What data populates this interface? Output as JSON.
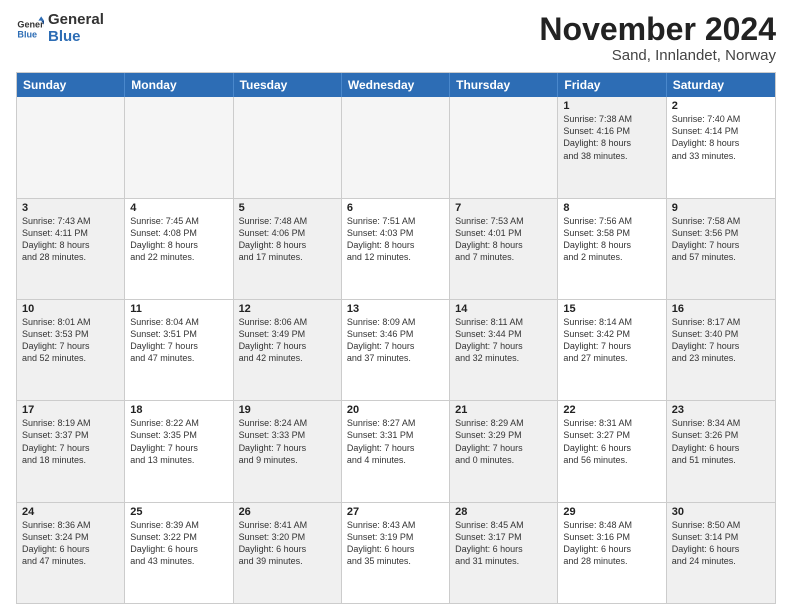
{
  "logo": {
    "line1": "General",
    "line2": "Blue"
  },
  "title": "November 2024",
  "subtitle": "Sand, Innlandet, Norway",
  "days": [
    "Sunday",
    "Monday",
    "Tuesday",
    "Wednesday",
    "Thursday",
    "Friday",
    "Saturday"
  ],
  "rows": [
    [
      {
        "day": "",
        "info": "",
        "empty": true
      },
      {
        "day": "",
        "info": "",
        "empty": true
      },
      {
        "day": "",
        "info": "",
        "empty": true
      },
      {
        "day": "",
        "info": "",
        "empty": true
      },
      {
        "day": "",
        "info": "",
        "empty": true
      },
      {
        "day": "1",
        "info": "Sunrise: 7:38 AM\nSunset: 4:16 PM\nDaylight: 8 hours\nand 38 minutes.",
        "shaded": true
      },
      {
        "day": "2",
        "info": "Sunrise: 7:40 AM\nSunset: 4:14 PM\nDaylight: 8 hours\nand 33 minutes.",
        "shaded": false
      }
    ],
    [
      {
        "day": "3",
        "info": "Sunrise: 7:43 AM\nSunset: 4:11 PM\nDaylight: 8 hours\nand 28 minutes.",
        "shaded": true
      },
      {
        "day": "4",
        "info": "Sunrise: 7:45 AM\nSunset: 4:08 PM\nDaylight: 8 hours\nand 22 minutes.",
        "shaded": false
      },
      {
        "day": "5",
        "info": "Sunrise: 7:48 AM\nSunset: 4:06 PM\nDaylight: 8 hours\nand 17 minutes.",
        "shaded": true
      },
      {
        "day": "6",
        "info": "Sunrise: 7:51 AM\nSunset: 4:03 PM\nDaylight: 8 hours\nand 12 minutes.",
        "shaded": false
      },
      {
        "day": "7",
        "info": "Sunrise: 7:53 AM\nSunset: 4:01 PM\nDaylight: 8 hours\nand 7 minutes.",
        "shaded": true
      },
      {
        "day": "8",
        "info": "Sunrise: 7:56 AM\nSunset: 3:58 PM\nDaylight: 8 hours\nand 2 minutes.",
        "shaded": false
      },
      {
        "day": "9",
        "info": "Sunrise: 7:58 AM\nSunset: 3:56 PM\nDaylight: 7 hours\nand 57 minutes.",
        "shaded": true
      }
    ],
    [
      {
        "day": "10",
        "info": "Sunrise: 8:01 AM\nSunset: 3:53 PM\nDaylight: 7 hours\nand 52 minutes.",
        "shaded": true
      },
      {
        "day": "11",
        "info": "Sunrise: 8:04 AM\nSunset: 3:51 PM\nDaylight: 7 hours\nand 47 minutes.",
        "shaded": false
      },
      {
        "day": "12",
        "info": "Sunrise: 8:06 AM\nSunset: 3:49 PM\nDaylight: 7 hours\nand 42 minutes.",
        "shaded": true
      },
      {
        "day": "13",
        "info": "Sunrise: 8:09 AM\nSunset: 3:46 PM\nDaylight: 7 hours\nand 37 minutes.",
        "shaded": false
      },
      {
        "day": "14",
        "info": "Sunrise: 8:11 AM\nSunset: 3:44 PM\nDaylight: 7 hours\nand 32 minutes.",
        "shaded": true
      },
      {
        "day": "15",
        "info": "Sunrise: 8:14 AM\nSunset: 3:42 PM\nDaylight: 7 hours\nand 27 minutes.",
        "shaded": false
      },
      {
        "day": "16",
        "info": "Sunrise: 8:17 AM\nSunset: 3:40 PM\nDaylight: 7 hours\nand 23 minutes.",
        "shaded": true
      }
    ],
    [
      {
        "day": "17",
        "info": "Sunrise: 8:19 AM\nSunset: 3:37 PM\nDaylight: 7 hours\nand 18 minutes.",
        "shaded": true
      },
      {
        "day": "18",
        "info": "Sunrise: 8:22 AM\nSunset: 3:35 PM\nDaylight: 7 hours\nand 13 minutes.",
        "shaded": false
      },
      {
        "day": "19",
        "info": "Sunrise: 8:24 AM\nSunset: 3:33 PM\nDaylight: 7 hours\nand 9 minutes.",
        "shaded": true
      },
      {
        "day": "20",
        "info": "Sunrise: 8:27 AM\nSunset: 3:31 PM\nDaylight: 7 hours\nand 4 minutes.",
        "shaded": false
      },
      {
        "day": "21",
        "info": "Sunrise: 8:29 AM\nSunset: 3:29 PM\nDaylight: 7 hours\nand 0 minutes.",
        "shaded": true
      },
      {
        "day": "22",
        "info": "Sunrise: 8:31 AM\nSunset: 3:27 PM\nDaylight: 6 hours\nand 56 minutes.",
        "shaded": false
      },
      {
        "day": "23",
        "info": "Sunrise: 8:34 AM\nSunset: 3:26 PM\nDaylight: 6 hours\nand 51 minutes.",
        "shaded": true
      }
    ],
    [
      {
        "day": "24",
        "info": "Sunrise: 8:36 AM\nSunset: 3:24 PM\nDaylight: 6 hours\nand 47 minutes.",
        "shaded": true
      },
      {
        "day": "25",
        "info": "Sunrise: 8:39 AM\nSunset: 3:22 PM\nDaylight: 6 hours\nand 43 minutes.",
        "shaded": false
      },
      {
        "day": "26",
        "info": "Sunrise: 8:41 AM\nSunset: 3:20 PM\nDaylight: 6 hours\nand 39 minutes.",
        "shaded": true
      },
      {
        "day": "27",
        "info": "Sunrise: 8:43 AM\nSunset: 3:19 PM\nDaylight: 6 hours\nand 35 minutes.",
        "shaded": false
      },
      {
        "day": "28",
        "info": "Sunrise: 8:45 AM\nSunset: 3:17 PM\nDaylight: 6 hours\nand 31 minutes.",
        "shaded": true
      },
      {
        "day": "29",
        "info": "Sunrise: 8:48 AM\nSunset: 3:16 PM\nDaylight: 6 hours\nand 28 minutes.",
        "shaded": false
      },
      {
        "day": "30",
        "info": "Sunrise: 8:50 AM\nSunset: 3:14 PM\nDaylight: 6 hours\nand 24 minutes.",
        "shaded": true
      }
    ]
  ]
}
